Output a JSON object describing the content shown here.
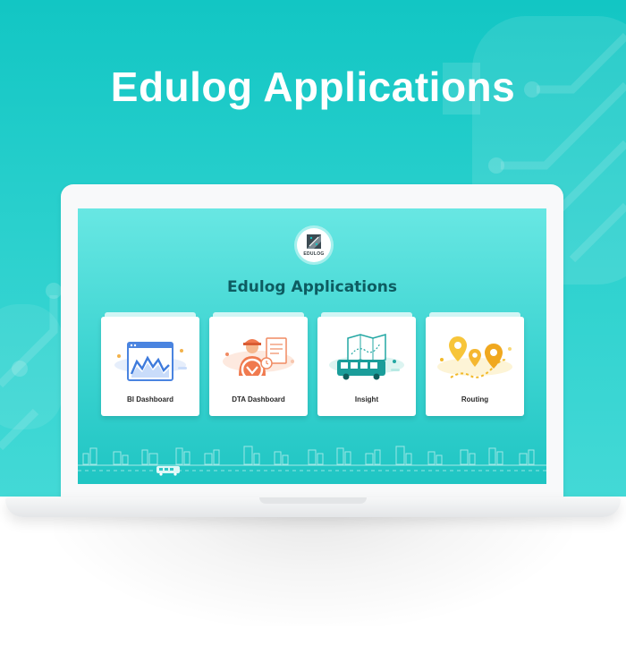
{
  "hero": {
    "title": "Edulog Applications"
  },
  "screen": {
    "logo_text": "EDULOG",
    "title": "Edulog Applications",
    "apps": [
      {
        "label": "BI Dashboard",
        "icon": "bi-dashboard-chart-icon"
      },
      {
        "label": "DTA Dashboard",
        "icon": "driver-steering-wheel-icon"
      },
      {
        "label": "Insight",
        "icon": "school-bus-map-icon"
      },
      {
        "label": "Routing",
        "icon": "route-location-pins-icon"
      }
    ]
  },
  "colors": {
    "hero_background": "#12c6c4",
    "screen_title": "#0d5c61",
    "card_background": "#ffffff"
  }
}
